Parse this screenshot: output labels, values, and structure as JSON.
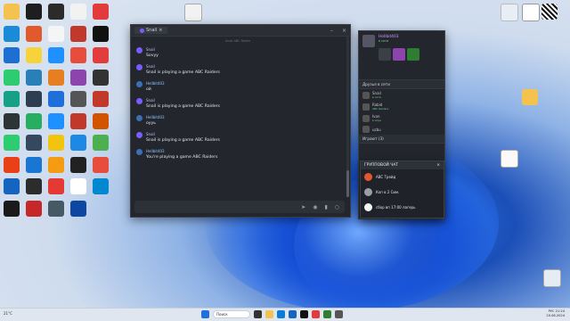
{
  "desktop": {
    "icons": [
      {
        "name": "folder",
        "color": "#f3c24f"
      },
      {
        "name": "app",
        "color": "#1e1e1e"
      },
      {
        "name": "app",
        "color": "#2b2b2b"
      },
      {
        "name": "app",
        "color": "#f2f2f2"
      },
      {
        "name": "app",
        "color": "#e23b3b"
      },
      {
        "name": "app",
        "color": "#1a8bd6"
      },
      {
        "name": "app",
        "color": "#e05a2b"
      },
      {
        "name": "doc",
        "color": "#f5f5f5"
      },
      {
        "name": "app",
        "color": "#c0392b"
      },
      {
        "name": "app",
        "color": "#111"
      },
      {
        "name": "app",
        "color": "#1d6fd1"
      },
      {
        "name": "app",
        "color": "#f7d33b"
      },
      {
        "name": "app",
        "color": "#1e90ff"
      },
      {
        "name": "app",
        "color": "#e74c3c"
      },
      {
        "name": "app",
        "color": "#e23d3d"
      },
      {
        "name": "app",
        "color": "#2ecc71"
      },
      {
        "name": "app",
        "color": "#2980b9"
      },
      {
        "name": "app",
        "color": "#e67e22"
      },
      {
        "name": "app",
        "color": "#8e44ad"
      },
      {
        "name": "app",
        "color": "#333"
      },
      {
        "name": "app",
        "color": "#16a085"
      },
      {
        "name": "app",
        "color": "#2c3e50"
      },
      {
        "name": "app",
        "color": "#1e6fd9"
      },
      {
        "name": "app",
        "color": "#555"
      },
      {
        "name": "app",
        "color": "#c0392b"
      },
      {
        "name": "app",
        "color": "#2d3436"
      },
      {
        "name": "app",
        "color": "#27ae60"
      },
      {
        "name": "app",
        "color": "#1e90ff"
      },
      {
        "name": "app",
        "color": "#c0392b"
      },
      {
        "name": "app",
        "color": "#d35400"
      },
      {
        "name": "app",
        "color": "#2ecc71"
      },
      {
        "name": "app",
        "color": "#34495e"
      },
      {
        "name": "app",
        "color": "#f1c40f"
      },
      {
        "name": "app",
        "color": "#1e88e5"
      },
      {
        "name": "app",
        "color": "#4caf50"
      },
      {
        "name": "app",
        "color": "#e84118"
      },
      {
        "name": "app",
        "color": "#1976d2"
      },
      {
        "name": "app",
        "color": "#f39c12"
      },
      {
        "name": "app",
        "color": "#222"
      },
      {
        "name": "app",
        "color": "#e74c3c"
      },
      {
        "name": "app",
        "color": "#1565c0"
      },
      {
        "name": "app",
        "color": "#2c2c2c"
      },
      {
        "name": "app",
        "color": "#e53935"
      },
      {
        "name": "app",
        "color": "#fff"
      },
      {
        "name": "app",
        "color": "#0288d1"
      },
      {
        "name": "app",
        "color": "#1a1a1a"
      },
      {
        "name": "app",
        "color": "#c62828"
      },
      {
        "name": "app",
        "color": "#455a64"
      },
      {
        "name": "app",
        "color": "#0d47a1"
      }
    ],
    "right_labels": [
      "",
      "",
      ""
    ]
  },
  "chat": {
    "tab_title": "Snail",
    "top_line": "Snail ABC Rader",
    "messages": [
      {
        "user": "Snail",
        "time": "",
        "text": "Sovyy",
        "user_color": "#c9b8ff"
      },
      {
        "user": "Snail",
        "time": "",
        "text": "Snail is playing a game  ABC Raiders",
        "user_color": "#c9b8ff"
      },
      {
        "user": "Hellbit403",
        "time": "",
        "text": "ой",
        "user_color": "#8fc3ff"
      },
      {
        "user": "Snail",
        "time": "",
        "text": "Snail is playing a game  ABC Raiders",
        "user_color": "#c9b8ff"
      },
      {
        "user": "Hellbit403",
        "time": "",
        "text": "оууь",
        "user_color": "#8fc3ff"
      },
      {
        "user": "Snail",
        "time": "",
        "text": "Snail is playing a game  ABC Raiders",
        "user_color": "#c9b8ff"
      },
      {
        "user": "Hellbit403",
        "time": "",
        "text": "You're playing a game  ABC Raiders",
        "user_color": "#8fc3ff"
      }
    ]
  },
  "friends": {
    "profile_name": "Hellbit403",
    "profile_status": "в сети",
    "section_friends": "Друзья в сети",
    "section_playing": "Играют (3)",
    "rows": [
      {
        "name": "Snail",
        "sub": "в сети"
      },
      {
        "name": "Rabid",
        "sub": "ABC Raiders"
      },
      {
        "name": "Ivan",
        "sub": "в игре"
      },
      {
        "name": "uzbu",
        "sub": ""
      }
    ]
  },
  "popup": {
    "title": "ГРУППОВОЙ ЧАТ",
    "items": [
      {
        "label": "ABC Трейд",
        "color": "#e4572e"
      },
      {
        "label": "Коп в 2 Сим.",
        "color": "#9aa0a6"
      },
      {
        "label": "сбор вп 17:00 лагерь",
        "color": "#f5f5f5"
      }
    ]
  },
  "taskbar": {
    "weather": "21°C",
    "search_placeholder": "Поиск",
    "time": "21:24",
    "date": "20.06.2024",
    "lang": "РУС"
  }
}
